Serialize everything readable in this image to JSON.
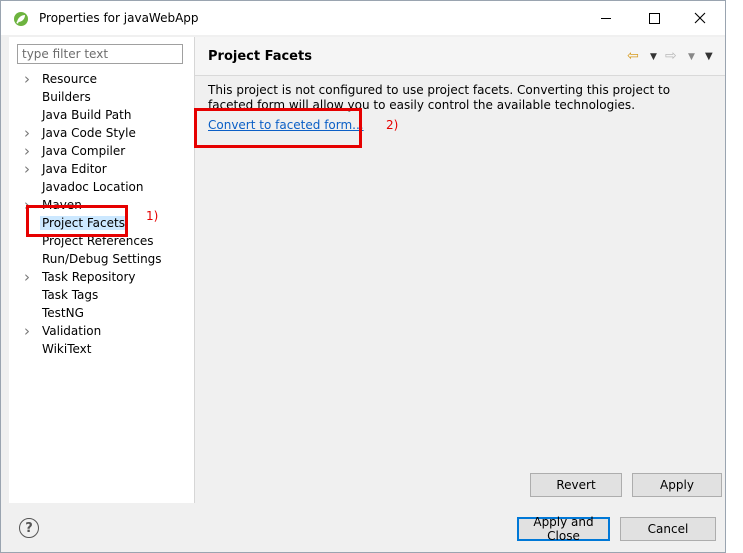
{
  "window": {
    "title": "Properties for javaWebApp"
  },
  "filter": {
    "placeholder": "type filter text",
    "value": ""
  },
  "tree": {
    "items": [
      {
        "label": "Resource",
        "expandable": true
      },
      {
        "label": "Builders",
        "expandable": false
      },
      {
        "label": "Java Build Path",
        "expandable": false
      },
      {
        "label": "Java Code Style",
        "expandable": true
      },
      {
        "label": "Java Compiler",
        "expandable": true
      },
      {
        "label": "Java Editor",
        "expandable": true
      },
      {
        "label": "Javadoc Location",
        "expandable": false
      },
      {
        "label": "Maven",
        "expandable": true
      },
      {
        "label": "Project Facets",
        "expandable": false,
        "selected": true
      },
      {
        "label": "Project References",
        "expandable": false
      },
      {
        "label": "Run/Debug Settings",
        "expandable": false
      },
      {
        "label": "Task Repository",
        "expandable": true
      },
      {
        "label": "Task Tags",
        "expandable": false
      },
      {
        "label": "TestNG",
        "expandable": false
      },
      {
        "label": "Validation",
        "expandable": true
      },
      {
        "label": "WikiText",
        "expandable": false
      }
    ]
  },
  "page": {
    "title": "Project Facets",
    "description": "This project is not configured to use project facets. Converting this project to faceted form will allow you to easily control the available technologies.",
    "convert_link": "Convert to faceted form..."
  },
  "buttons": {
    "revert": "Revert",
    "apply": "Apply",
    "apply_close": "Apply and Close",
    "cancel": "Cancel"
  },
  "annotations": {
    "label1": "1)",
    "label2": "2)"
  },
  "colors": {
    "annotation": "#e60000",
    "link": "#0b5fc6",
    "selection": "#cce8ff"
  }
}
